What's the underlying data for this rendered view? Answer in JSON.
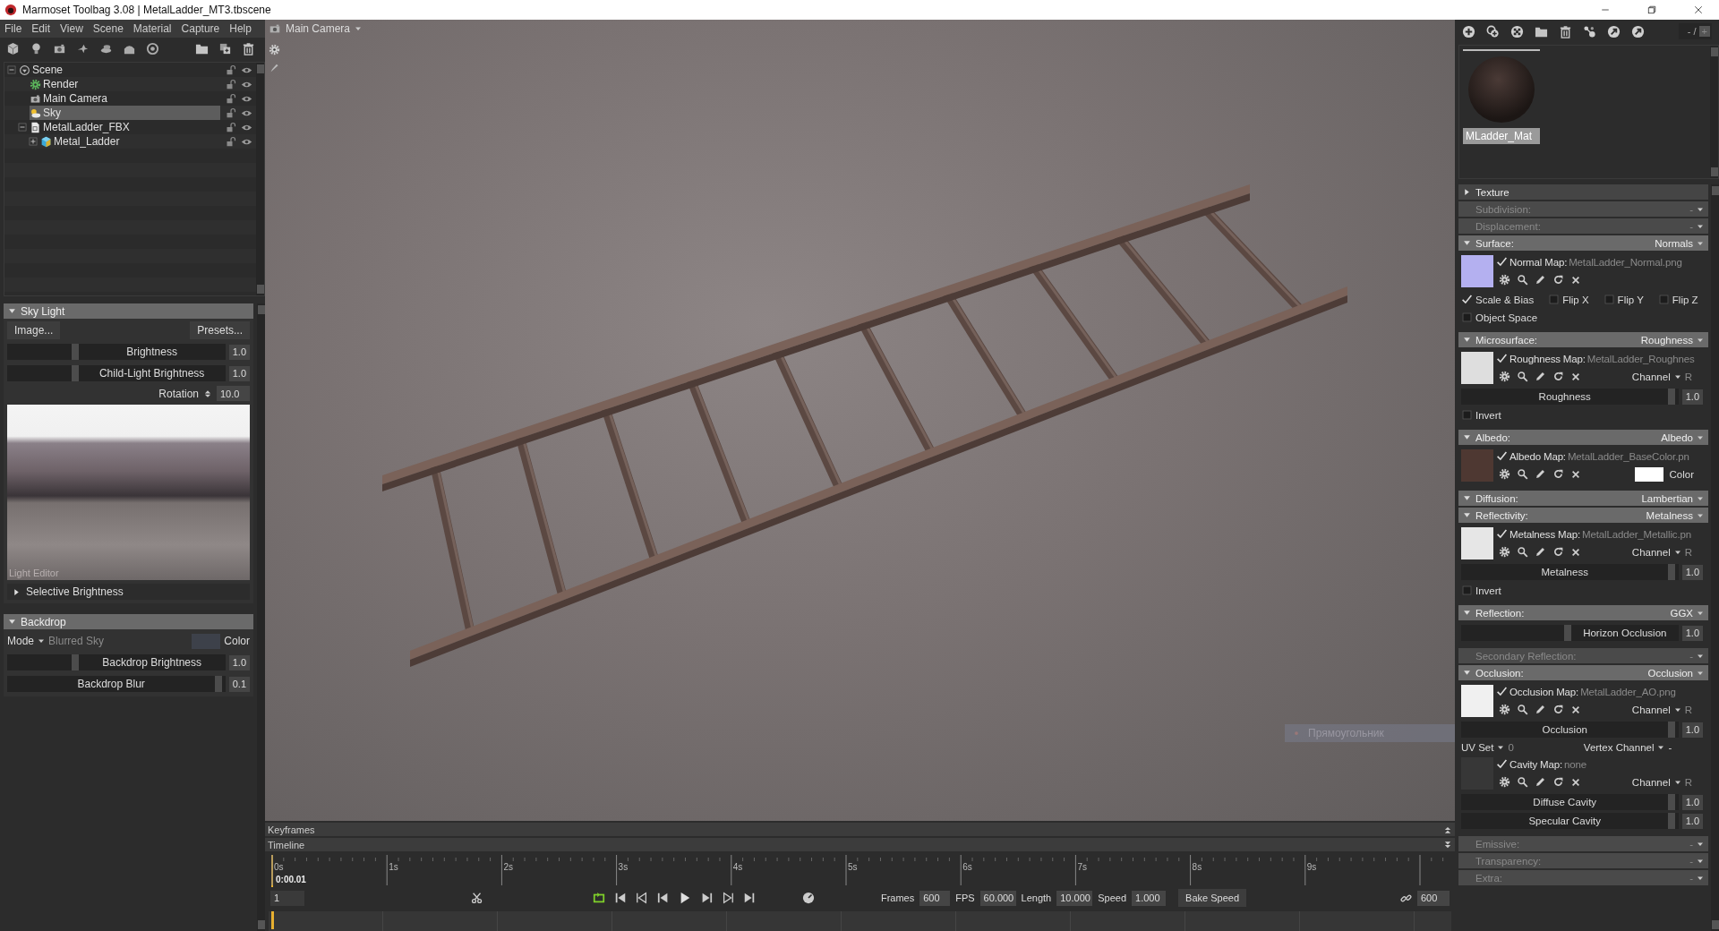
{
  "window": {
    "title": "Marmoset Toolbag 3.08 | MetalLadder_MT3.tbscene"
  },
  "menu": [
    "File",
    "Edit",
    "View",
    "Scene",
    "Material",
    "Capture",
    "Help"
  ],
  "scene_tree": {
    "nodes": [
      {
        "label": "Scene",
        "kind": "scene",
        "selected": false,
        "expanded": true,
        "children": [
          {
            "label": "Render",
            "kind": "render",
            "selected": false
          },
          {
            "label": "Main Camera",
            "kind": "camera",
            "selected": false
          },
          {
            "label": "Sky",
            "kind": "sky",
            "selected": true
          },
          {
            "label": "MetalLadder_FBX",
            "kind": "file",
            "selected": false,
            "expanded": true,
            "children": [
              {
                "label": "Metal_Ladder",
                "kind": "mesh",
                "selected": false,
                "expanded": false
              }
            ]
          }
        ]
      }
    ]
  },
  "sky_light": {
    "title": "Sky Light",
    "expanded": true,
    "image_button": "Image...",
    "presets_button": "Presets...",
    "sliders": [
      {
        "label": "Brightness",
        "value": "1.0",
        "level": 0.31
      },
      {
        "label": "Child-Light Brightness",
        "value": "1.0",
        "level": 0.31
      }
    ],
    "rotation": {
      "label": "Rotation",
      "value": "10.0"
    },
    "preview_caption": "Light Editor",
    "selective": {
      "label": "Selective Brightness",
      "expanded": false
    }
  },
  "backdrop": {
    "title": "Backdrop",
    "expanded": true,
    "mode_label": "Mode",
    "mode": "Blurred Sky",
    "color_label": "Color",
    "sliders": [
      {
        "label": "Backdrop Brightness",
        "value": "1.0",
        "level": 0.31
      },
      {
        "label": "Backdrop Blur",
        "value": "0.1",
        "level": 0.97
      }
    ]
  },
  "viewport": {
    "camera": "Main Camera",
    "tooltip": "Прямоугольник"
  },
  "timeline": {
    "keyframes_label": "Keyframes",
    "timeline_label": "Timeline",
    "ruler_labels": [
      "0s",
      "1s",
      "2s",
      "3s",
      "4s",
      "5s",
      "6s",
      "7s",
      "8s",
      "9s"
    ],
    "current_time": "0:00.01",
    "frame": "1",
    "frames_label": "Frames",
    "frames": "600",
    "fps_label": "FPS",
    "fps": "60.000",
    "length_label": "Length",
    "length": "10.000",
    "speed_label": "Speed",
    "speed": "1.000",
    "bake_button": "Bake Speed",
    "end_frame": "600"
  },
  "material": {
    "counter": "- /",
    "counter_button": "+",
    "materials": [
      {
        "name": "MLadder_Mat",
        "selected": true
      }
    ],
    "sections": [
      {
        "title": "Texture",
        "kind": "group",
        "expanded": false
      },
      {
        "title": "Subdivision:",
        "kind": "module",
        "value": "-",
        "disabled": true
      },
      {
        "title": "Displacement:",
        "kind": "module",
        "value": "-",
        "disabled": true
      },
      {
        "title": "Surface:",
        "kind": "module",
        "value": "Normals",
        "disabled": false,
        "expanded": true,
        "rows": [
          {
            "kind": "map",
            "checked": true,
            "label": "Normal Map:",
            "file": "MetalLadder_Normal.png",
            "color": "#b4b0f0"
          },
          {
            "kind": "checks",
            "items": [
              {
                "label": "Scale & Bias",
                "checked": true
              },
              {
                "label": "Flip X",
                "checked": false
              },
              {
                "label": "Flip Y",
                "checked": false
              },
              {
                "label": "Flip Z",
                "checked": false
              }
            ]
          },
          {
            "kind": "checks",
            "items": [
              {
                "label": "Object Space",
                "checked": false
              }
            ]
          }
        ]
      },
      {
        "title": "Microsurface:",
        "kind": "module",
        "value": "Roughness",
        "disabled": false,
        "expanded": true,
        "rows": [
          {
            "kind": "map",
            "checked": true,
            "label": "Roughness Map:",
            "file": "MetalLadder_Roughnes",
            "color": "#dedede",
            "channel_label": "Channel",
            "channel": "R"
          },
          {
            "kind": "slider",
            "label": "Roughness",
            "value": "1.0",
            "level": 0.97
          },
          {
            "kind": "checks",
            "items": [
              {
                "label": "Invert",
                "checked": false
              }
            ]
          }
        ]
      },
      {
        "title": "Albedo:",
        "kind": "module",
        "value": "Albedo",
        "disabled": false,
        "expanded": true,
        "rows": [
          {
            "kind": "map",
            "checked": true,
            "label": "Albedo Map:",
            "file": "MetalLadder_BaseColor.pn",
            "color": "#4e3832",
            "color_label": "Color"
          }
        ]
      },
      {
        "title": "Diffusion:",
        "kind": "module",
        "value": "Lambertian",
        "disabled": false,
        "expanded": true
      },
      {
        "title": "Reflectivity:",
        "kind": "module",
        "value": "Metalness",
        "disabled": false,
        "expanded": true,
        "rows": [
          {
            "kind": "map",
            "checked": true,
            "label": "Metalness Map:",
            "file": "MetalLadder_Metallic.pn",
            "color": "#e6e6e6",
            "channel_label": "Channel",
            "channel": "R"
          },
          {
            "kind": "slider",
            "label": "Metalness",
            "value": "1.0",
            "level": 0.97
          },
          {
            "kind": "checks",
            "items": [
              {
                "label": "Invert",
                "checked": false
              }
            ]
          }
        ]
      },
      {
        "title": "Reflection:",
        "kind": "module",
        "value": "GGX",
        "disabled": false,
        "expanded": true,
        "rows": [
          {
            "kind": "slider",
            "label": "Horizon Occlusion",
            "value": "1.0",
            "level": 0.49
          }
        ]
      },
      {
        "title": "Secondary Reflection:",
        "kind": "module",
        "value": "-",
        "disabled": true
      },
      {
        "title": "Occlusion:",
        "kind": "module",
        "value": "Occlusion",
        "disabled": false,
        "expanded": true,
        "rows": [
          {
            "kind": "map",
            "checked": true,
            "label": "Occlusion Map:",
            "file": "MetalLadder_AO.png",
            "color": "#f0f0f0",
            "channel_label": "Channel",
            "channel": "R"
          },
          {
            "kind": "slider",
            "label": "Occlusion",
            "value": "1.0",
            "level": 0.97
          },
          {
            "kind": "uvset",
            "label": "UV Set",
            "value": "0",
            "vertex_label": "Vertex Channel",
            "vertex_value": "-"
          },
          {
            "kind": "map",
            "checked": true,
            "label": "Cavity Map:",
            "file": "none",
            "color": "#373737",
            "channel_label": "Channel",
            "channel": "R"
          },
          {
            "kind": "slider",
            "label": "Diffuse Cavity",
            "value": "1.0",
            "level": 0.97
          },
          {
            "kind": "slider",
            "label": "Specular Cavity",
            "value": "1.0",
            "level": 0.97
          }
        ]
      },
      {
        "title": "Emissive:",
        "kind": "module",
        "value": "-",
        "disabled": true
      },
      {
        "title": "Transparency:",
        "kind": "module",
        "value": "-",
        "disabled": true
      },
      {
        "title": "Extra:",
        "kind": "module",
        "value": "-",
        "disabled": true
      }
    ]
  }
}
